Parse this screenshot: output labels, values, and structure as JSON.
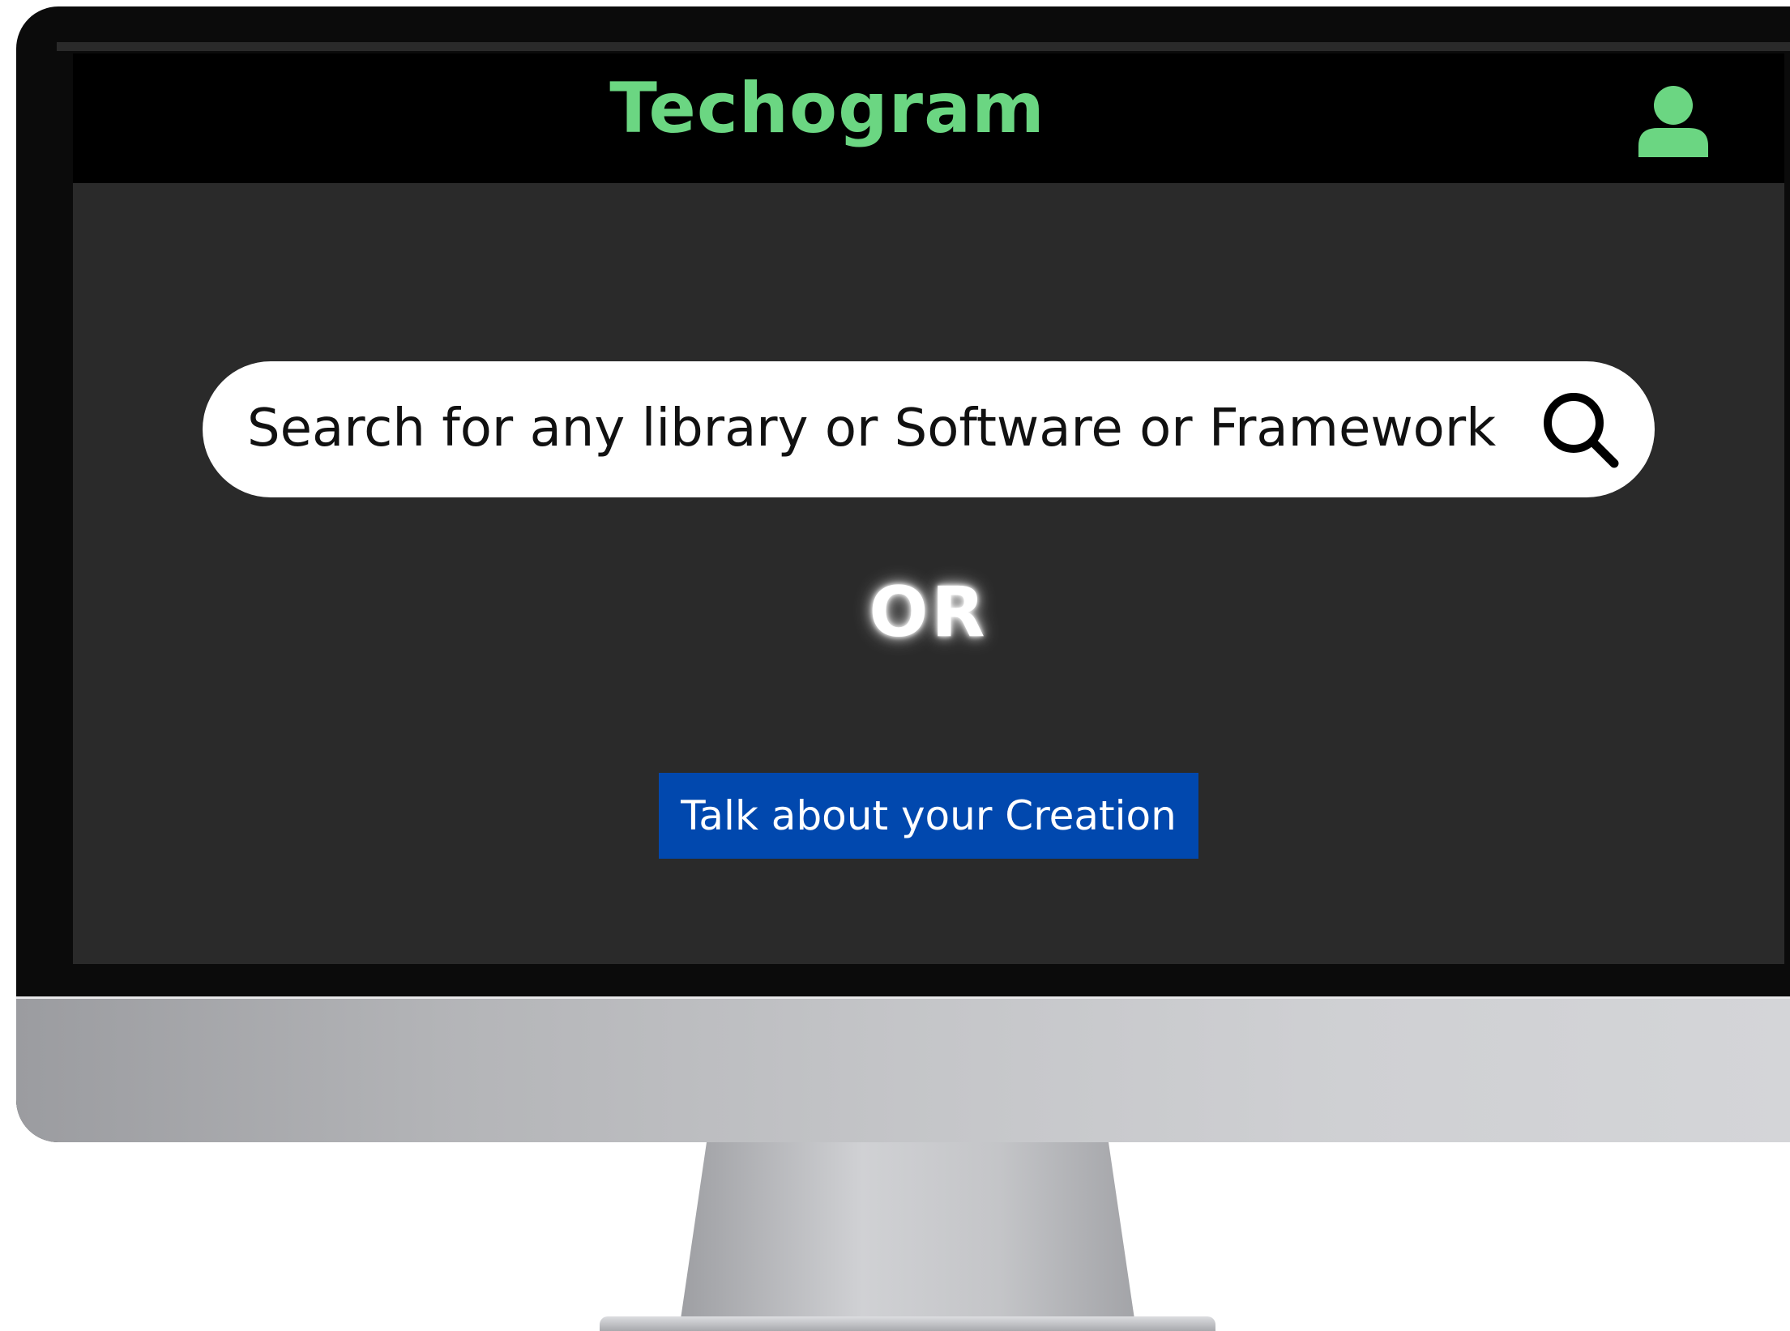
{
  "header": {
    "brand": "Techogram",
    "user_icon": "user-icon"
  },
  "search": {
    "placeholder": "Search for any library or Software or Framework",
    "icon": "search-icon"
  },
  "divider": {
    "label": "OR"
  },
  "cta": {
    "label": "Talk about your Creation"
  },
  "colors": {
    "brand": "#6bd682",
    "header_bg": "#000000",
    "screen_bg": "#2a2a2a",
    "cta_bg": "#0148ae",
    "search_bg": "#ffffff"
  }
}
